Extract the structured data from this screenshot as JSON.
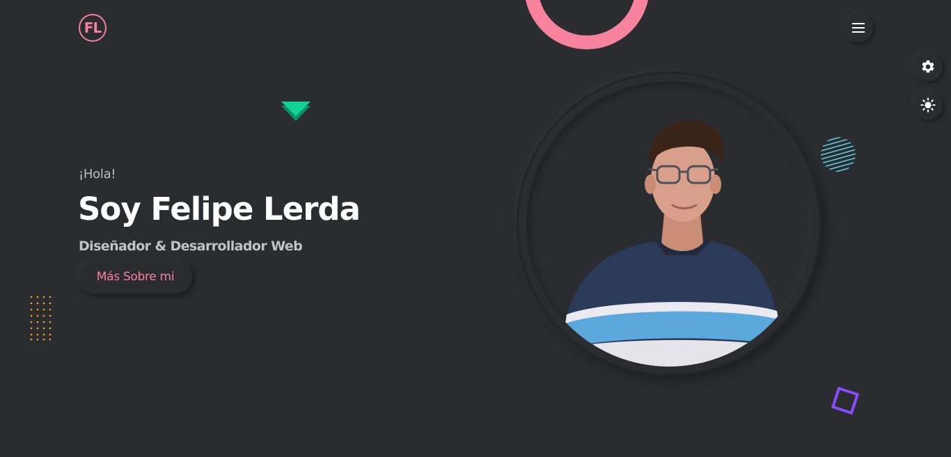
{
  "header": {
    "logo_text": "FL",
    "menu_icon": "hamburger-menu-icon"
  },
  "side_controls": {
    "settings_icon": "gear-icon",
    "theme_icon": "sun-icon"
  },
  "hero": {
    "greeting": "¡Hola!",
    "name": "Soy Felipe Lerda",
    "subtitle": "Diseñador & Desarrollador Web",
    "cta_label": "Más Sobre mi"
  },
  "colors": {
    "background": "#2b2c30",
    "accent_pink": "#f6829e",
    "accent_green": "#12d396",
    "accent_orange": "#f5a623",
    "accent_cyan": "#5ad1e3",
    "accent_purple": "#8a4bff"
  }
}
